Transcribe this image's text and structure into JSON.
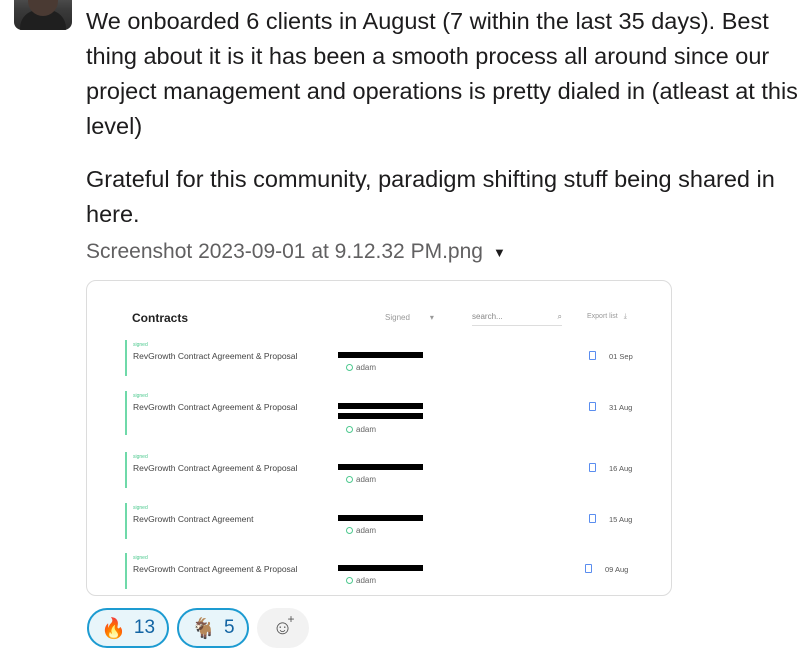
{
  "message": {
    "paragraph_1": "We onboarded 6 clients in August (7 within the last 35 days). Best thing about it is it has been a smooth process all around since our project management and operations is pretty dialed in (atleast at this level)",
    "paragraph_2": "Grateful for this community, paradigm shifting stuff being shared in here."
  },
  "attachment": {
    "file_name": "Screenshot 2023-09-01 at 9.12.32 PM.png",
    "contracts_title": "Contracts",
    "filter_label": "Signed",
    "search_placeholder": "search...",
    "export_label": "Export list",
    "rows": [
      {
        "status": "signed",
        "title": "RevGrowth Contract Agreement & Proposal",
        "user": "adam",
        "date": "01 Sep"
      },
      {
        "status": "signed",
        "title": "RevGrowth Contract Agreement & Proposal",
        "user": "adam",
        "date": "31 Aug"
      },
      {
        "status": "signed",
        "title": "RevGrowth Contract Agreement & Proposal",
        "user": "adam",
        "date": "16 Aug"
      },
      {
        "status": "signed",
        "title": "RevGrowth Contract Agreement",
        "user": "adam",
        "date": "15 Aug"
      },
      {
        "status": "signed",
        "title": "RevGrowth Contract Agreement & Proposal",
        "user": "adam",
        "date": "09 Aug"
      }
    ]
  },
  "reactions": [
    {
      "emoji": "🔥",
      "icon": "fire-icon",
      "count": "13"
    },
    {
      "emoji": "🐐",
      "icon": "goat-icon",
      "count": "5"
    }
  ],
  "colors": {
    "accent": "#1d9bd1",
    "reaction_bg": "#e8f5fa",
    "signed_green": "#4ec98f"
  }
}
